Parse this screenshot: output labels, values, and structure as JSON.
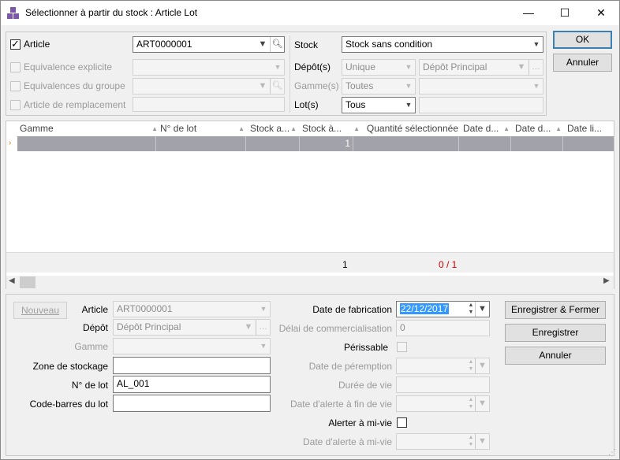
{
  "window": {
    "title": "Sélectionner à partir du stock : Article Lot",
    "minimize": "—",
    "maximize": "☐",
    "close": "✕"
  },
  "filters": {
    "article": {
      "label": "Article",
      "checked": true,
      "value": "ART0000001"
    },
    "equiv_explicit": {
      "label": "Equivalence explicite"
    },
    "equiv_group": {
      "label": "Equivalences du groupe"
    },
    "replacement": {
      "label": "Article de remplacement"
    },
    "stock": {
      "label": "Stock",
      "value": "Stock sans condition"
    },
    "depot": {
      "label": "Dépôt(s)",
      "mode": "Unique",
      "value": "Dépôt Principal"
    },
    "gamme": {
      "label": "Gamme(s)",
      "mode": "Toutes"
    },
    "lot": {
      "label": "Lot(s)",
      "mode": "Tous"
    }
  },
  "actions": {
    "ok": "OK",
    "cancel": "Annuler"
  },
  "grid": {
    "columns": [
      "Gamme",
      "N° de lot",
      "Stock a...",
      "Stock à...",
      "Quantité sélectionnée",
      "Date d...",
      "Date d...",
      "Date li..."
    ],
    "row": {
      "stock_a2": "1"
    },
    "footer": {
      "total": "1",
      "selection": "0 / 1"
    }
  },
  "form": {
    "new_button": "Nouveau",
    "article_label": "Article",
    "article_value": "ART0000001",
    "depot_label": "Dépôt",
    "depot_value": "Dépôt Principal",
    "gamme_label": "Gamme",
    "zone_label": "Zone de stockage",
    "zone_value": "",
    "lot_label": "N° de lot",
    "lot_value": "AL_001",
    "barcode_label": "Code-barres du lot",
    "barcode_value": "",
    "fab_label": "Date de fabrication",
    "fab_value": "22/12/2017",
    "delai_label": "Délai de commercialisation",
    "delai_value": "0",
    "perissable_label": "Périssable",
    "peremption_label": "Date de péremption",
    "duree_label": "Durée de vie",
    "alerte_fin_label": "Date d'alerte à fin de vie",
    "alerter_label": "Alerter à mi-vie",
    "alerte_mi_label": "Date d'alerte à mi-vie",
    "save_close": "Enregistrer & Fermer",
    "save": "Enregistrer",
    "cancel": "Annuler"
  },
  "colors": {
    "accent": "#3c7fb1",
    "selection_row": "#a2a2aa",
    "error_text": "#d40000"
  }
}
